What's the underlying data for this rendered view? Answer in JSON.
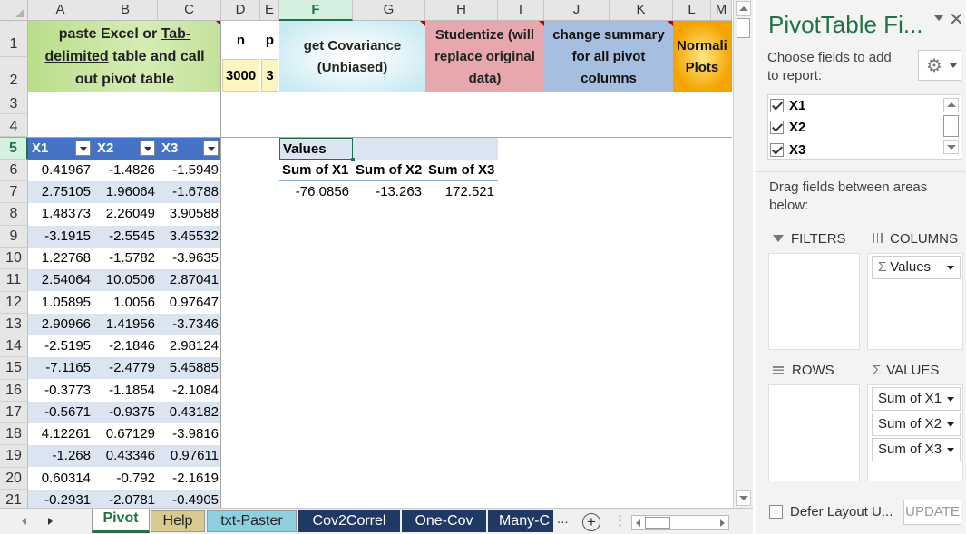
{
  "columns": [
    "A",
    "B",
    "C",
    "D",
    "E",
    "F",
    "G",
    "H",
    "I",
    "J",
    "K",
    "L",
    "M"
  ],
  "rows": [
    "1",
    "2",
    "3",
    "4",
    "5",
    "6",
    "7",
    "8",
    "9",
    "10",
    "11",
    "12",
    "13",
    "14",
    "15",
    "16",
    "17",
    "18",
    "19",
    "20",
    "21"
  ],
  "header_boxes": {
    "paste": [
      "paste Excel or ",
      "Tab-",
      "delimited",
      " table and call",
      "out pivot table"
    ],
    "n_label": "n",
    "p_label": "p",
    "n_value": "3000",
    "p_value": "3",
    "covariance": [
      "get Covariance",
      "(Unbiased)"
    ],
    "studentize": [
      "Studentize (will",
      "replace original",
      "data)"
    ],
    "change_summary": [
      "change summary",
      "for all pivot",
      "columns"
    ],
    "normali": [
      "Normali",
      "Plots"
    ]
  },
  "table": {
    "headers": [
      "X1",
      "X2",
      "X3"
    ],
    "rows": [
      [
        "0.41967",
        "-1.4826",
        "-1.5949"
      ],
      [
        "2.75105",
        "1.96064",
        "-1.6788"
      ],
      [
        "1.48373",
        "2.26049",
        "3.90588"
      ],
      [
        "-3.1915",
        "-2.5545",
        "3.45532"
      ],
      [
        "1.22768",
        "-1.5782",
        "-3.9635"
      ],
      [
        "2.54064",
        "10.0506",
        "2.87041"
      ],
      [
        "1.05895",
        "1.0056",
        "0.97647"
      ],
      [
        "2.90966",
        "1.41956",
        "-3.7346"
      ],
      [
        "-2.5195",
        "-2.1846",
        "2.98124"
      ],
      [
        "-7.1165",
        "-2.4779",
        "5.45885"
      ],
      [
        "-0.3773",
        "-1.1854",
        "-2.1084"
      ],
      [
        "-0.5671",
        "-0.9375",
        "0.43182"
      ],
      [
        "4.12261",
        "0.67129",
        "-3.9816"
      ],
      [
        "-1.268",
        "0.43346",
        "0.97611"
      ],
      [
        "0.60314",
        "-0.792",
        "-2.1619"
      ],
      [
        "-0.2931",
        "-2.0781",
        "-0.4905"
      ]
    ]
  },
  "pivot": {
    "values_label": "Values",
    "headers": [
      "Sum of X1",
      "Sum of X2",
      "Sum of X3"
    ],
    "values": [
      "-76.0856",
      "-13.263",
      "172.521"
    ]
  },
  "tabs": [
    "Pivot",
    "Help",
    "txt-Paster",
    "Cov2Correl",
    "One-Cov",
    "Many-C"
  ],
  "tabs_more": "...",
  "pane": {
    "title": "PivotTable Fi...",
    "choose": [
      "Choose fields to add",
      "to report:"
    ],
    "fields": [
      "X1",
      "X2",
      "X3"
    ],
    "drag": [
      "Drag fields between areas",
      "below:"
    ],
    "filters": "FILTERS",
    "columns": "COLUMNS",
    "rows": "ROWS",
    "values": "VALUES",
    "columns_items": [
      "Values"
    ],
    "values_items": [
      "Sum of X1",
      "Sum of X2",
      "Sum of X3"
    ],
    "defer": "Defer Layout U...",
    "update": "UPDATE",
    "sigma": "Σ"
  },
  "colors": {
    "green_box": "#c8e6a0",
    "yellow_box": "#fdf5c0",
    "blue_box": "#c8e8f0",
    "red_box": "#e8a8ac",
    "purple_box": "#a6bfe0",
    "orange_box": "#f6a800",
    "table_header": "#4472c4",
    "table_band": "#dbe5f1",
    "excel_green": "#217346",
    "tab_dark": "#1f3864",
    "tab_khaki": "#d6ca8e",
    "tab_teal": "#8ed0e0"
  }
}
